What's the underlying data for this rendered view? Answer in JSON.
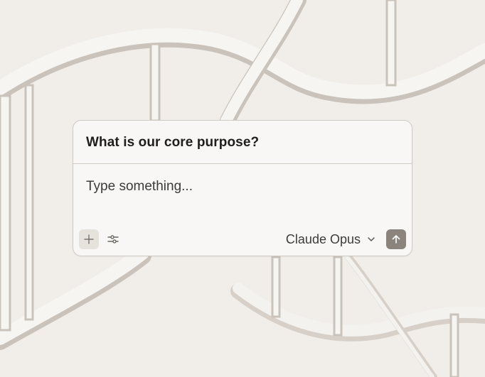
{
  "composer": {
    "question": "What is our core purpose?",
    "input_value": "",
    "input_placeholder": "Type something...",
    "model_label": "Claude Opus"
  },
  "icons": {
    "add": "plus-icon",
    "tools": "sliders-icon",
    "model_dropdown": "chevron-down-icon",
    "send": "arrow-up-icon"
  },
  "colors": {
    "background": "#f1eeea",
    "card": "#f8f7f5",
    "border": "#cfcac4",
    "send_button": "#8a847c"
  }
}
